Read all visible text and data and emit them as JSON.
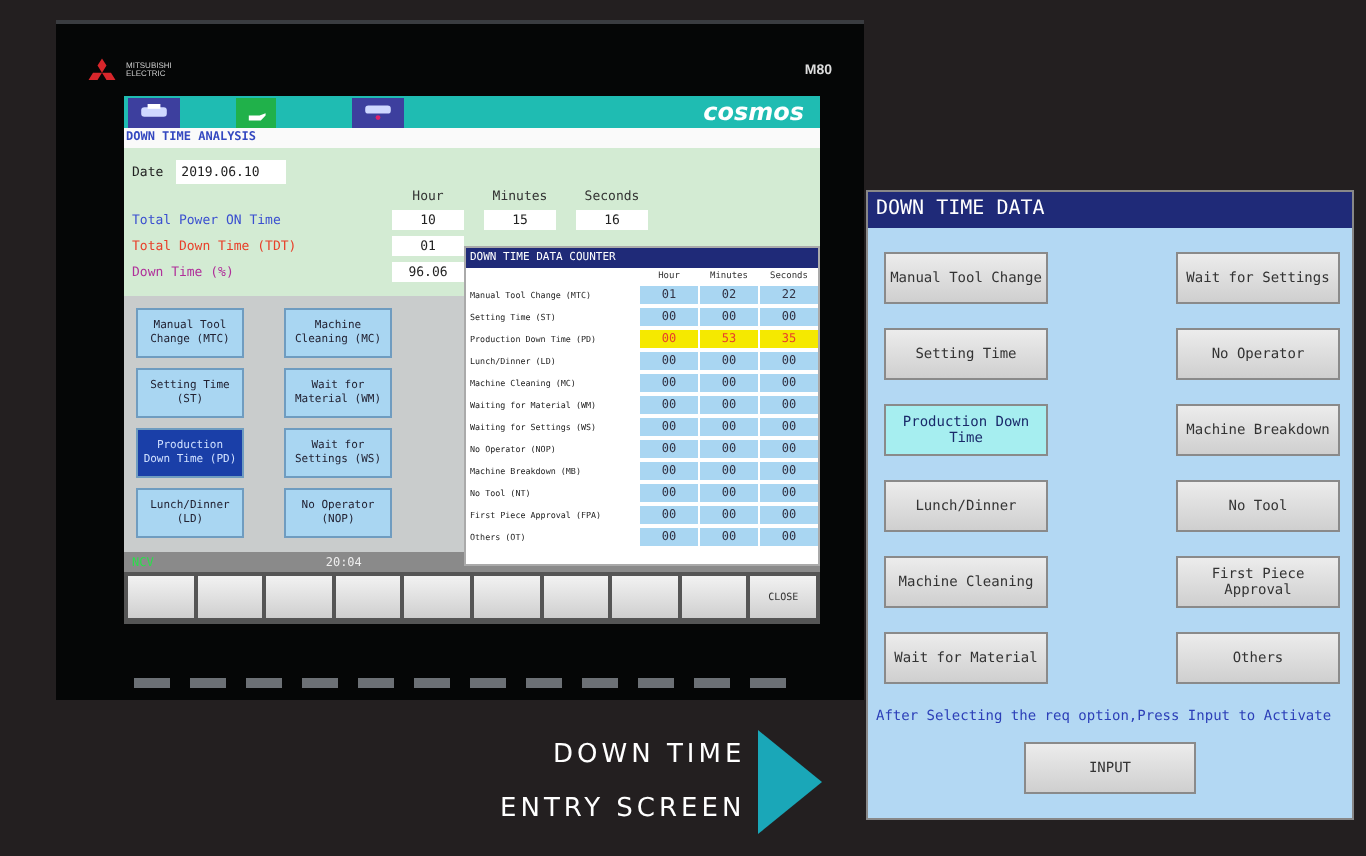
{
  "device": {
    "brand_lines": [
      "MITSUBISHI",
      "ELECTRIC"
    ],
    "model": "M80"
  },
  "screen": {
    "logo": "cosmos",
    "title": "DOWN TIME ANALYSIS",
    "date_label": "Date",
    "date": "2019.06.10",
    "time_headers": [
      "Hour",
      "Minutes",
      "Seconds"
    ],
    "time_rows": [
      {
        "label": "Total Power ON Time",
        "color": "#3a4fd0",
        "values": [
          "10",
          "15",
          "16"
        ]
      },
      {
        "label": "Total Down Time (TDT)",
        "color": "#e8402a",
        "values": [
          "01"
        ]
      },
      {
        "label": "Down Time (%)",
        "color": "#b0309a",
        "values": [
          "96.06"
        ]
      }
    ],
    "category_buttons": [
      {
        "label": "Manual Tool Change (MTC)",
        "selected": false
      },
      {
        "label": "Machine Cleaning (MC)",
        "selected": false
      },
      {
        "label": "Setting Time (ST)",
        "selected": false
      },
      {
        "label": "Wait for Material (WM)",
        "selected": false
      },
      {
        "label": "Production Down Time (PD)",
        "selected": true
      },
      {
        "label": "Wait for Settings (WS)",
        "selected": false
      },
      {
        "label": "Lunch/Dinner (LD)",
        "selected": false
      },
      {
        "label": "No Operator (NOP)",
        "selected": false
      }
    ],
    "status_bar": {
      "mode": "NCV",
      "time": "20:04"
    },
    "function_keys": [
      "CLOSE"
    ],
    "counter": {
      "title": "DOWN TIME DATA COUNTER",
      "headers": [
        "Hour",
        "Minutes",
        "Seconds"
      ],
      "rows": [
        {
          "label": "Manual Tool Change (MTC)",
          "values": [
            "01",
            "02",
            "22"
          ],
          "selected": false
        },
        {
          "label": "Setting Time (ST)",
          "values": [
            "00",
            "00",
            "00"
          ],
          "selected": false
        },
        {
          "label": "Production Down Time (PD)",
          "values": [
            "00",
            "53",
            "35"
          ],
          "selected": true
        },
        {
          "label": "Lunch/Dinner (LD)",
          "values": [
            "00",
            "00",
            "00"
          ],
          "selected": false
        },
        {
          "label": "Machine Cleaning (MC)",
          "values": [
            "00",
            "00",
            "00"
          ],
          "selected": false
        },
        {
          "label": "Waiting for Material (WM)",
          "values": [
            "00",
            "00",
            "00"
          ],
          "selected": false
        },
        {
          "label": "Waiting for Settings (WS)",
          "values": [
            "00",
            "00",
            "00"
          ],
          "selected": false
        },
        {
          "label": "No Operator (NOP)",
          "values": [
            "00",
            "00",
            "00"
          ],
          "selected": false
        },
        {
          "label": "Machine Breakdown (MB)",
          "values": [
            "00",
            "00",
            "00"
          ],
          "selected": false
        },
        {
          "label": "No Tool (NT)",
          "values": [
            "00",
            "00",
            "00"
          ],
          "selected": false
        },
        {
          "label": "First Piece Approval (FPA)",
          "values": [
            "00",
            "00",
            "00"
          ],
          "selected": false
        },
        {
          "label": "Others (OT)",
          "values": [
            "00",
            "00",
            "00"
          ],
          "selected": false
        }
      ]
    }
  },
  "caption": [
    "DOWN TIME",
    "ENTRY SCREEN"
  ],
  "inset": {
    "title": "DOWN TIME DATA",
    "options": [
      {
        "label": "Manual Tool Change",
        "selected": false
      },
      {
        "label": "Wait for Settings",
        "selected": false
      },
      {
        "label": "Setting Time",
        "selected": false
      },
      {
        "label": "No Operator",
        "selected": false
      },
      {
        "label": "Production Down Time",
        "selected": true
      },
      {
        "label": "Machine Breakdown",
        "selected": false
      },
      {
        "label": "Lunch/Dinner",
        "selected": false
      },
      {
        "label": "No Tool",
        "selected": false
      },
      {
        "label": "Machine Cleaning",
        "selected": false
      },
      {
        "label": "First Piece Approval",
        "selected": false
      },
      {
        "label": "Wait for Material",
        "selected": false
      },
      {
        "label": "Others",
        "selected": false
      }
    ],
    "note": "After Selecting the req option,Press Input to Activate",
    "button": "INPUT"
  }
}
